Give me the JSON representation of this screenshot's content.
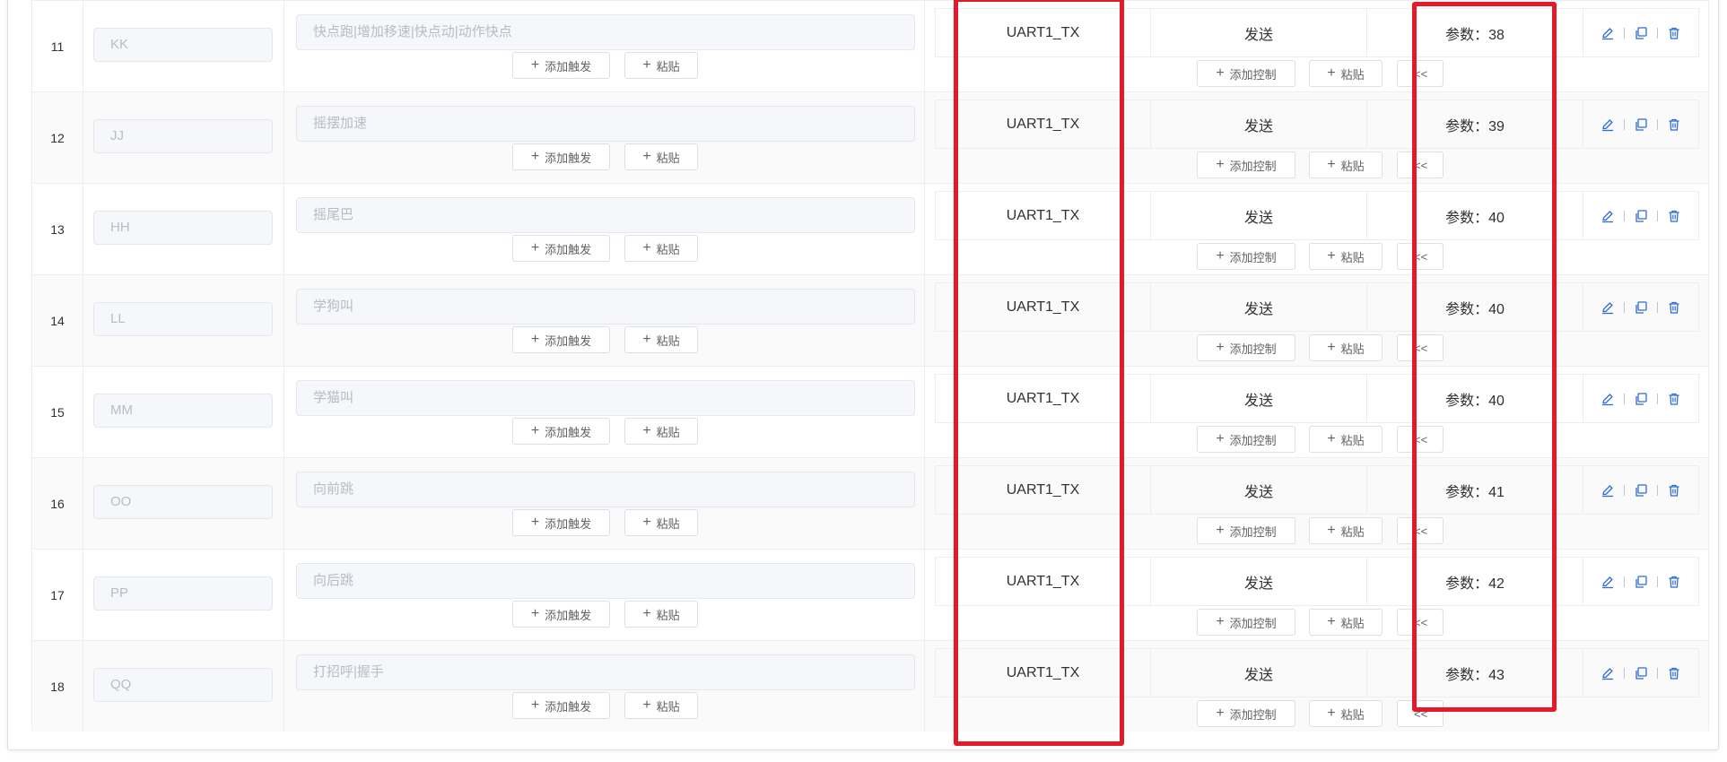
{
  "rows": [
    {
      "index": "11",
      "key": "KK",
      "trigger": "快点跑|增加移速|快点动|动作快点",
      "target": "UART1_TX",
      "action": "发送",
      "param": "参数：38"
    },
    {
      "index": "12",
      "key": "JJ",
      "trigger": "摇摆加速",
      "target": "UART1_TX",
      "action": "发送",
      "param": "参数：39"
    },
    {
      "index": "13",
      "key": "HH",
      "trigger": "摇尾巴",
      "target": "UART1_TX",
      "action": "发送",
      "param": "参数：40"
    },
    {
      "index": "14",
      "key": "LL",
      "trigger": "学狗叫",
      "target": "UART1_TX",
      "action": "发送",
      "param": "参数：40"
    },
    {
      "index": "15",
      "key": "MM",
      "trigger": "学猫叫",
      "target": "UART1_TX",
      "action": "发送",
      "param": "参数：40"
    },
    {
      "index": "16",
      "key": "OO",
      "trigger": "向前跳",
      "target": "UART1_TX",
      "action": "发送",
      "param": "参数：41"
    },
    {
      "index": "17",
      "key": "PP",
      "trigger": "向后跳",
      "target": "UART1_TX",
      "action": "发送",
      "param": "参数：42"
    },
    {
      "index": "18",
      "key": "QQ",
      "trigger": "打招呼|握手",
      "target": "UART1_TX",
      "action": "发送",
      "param": "参数：43"
    }
  ],
  "buttons": {
    "add_trigger": "添加触发",
    "paste": "粘贴",
    "add_control": "添加控制",
    "collapse": "<<"
  },
  "icons": {
    "edit": "edit-icon",
    "copy": "copy-icon",
    "delete": "delete-icon",
    "plus": "plus-icon"
  },
  "colors": {
    "highlight": "#e21b2a",
    "action_icon": "#2f6bd8"
  }
}
